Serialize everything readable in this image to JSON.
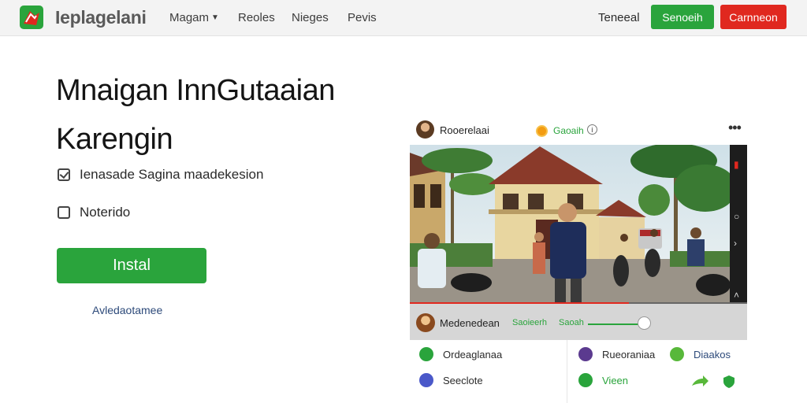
{
  "header": {
    "brand": "Ieplagelani",
    "nav": [
      {
        "label": "Magam",
        "has_dropdown": true
      },
      {
        "label": "Reoles",
        "has_dropdown": false
      },
      {
        "label": "Nieges",
        "has_dropdown": false
      },
      {
        "label": "Pevis",
        "has_dropdown": false
      }
    ],
    "link": "Teneeal",
    "green_button": "Senoeih",
    "red_button": "Carnneon"
  },
  "hero": {
    "title_line1": "Mnaigan InnGutaaian",
    "title_line2": "Karengin",
    "features": [
      {
        "label": "Ienasade Sagina maadekesion",
        "checked": true
      },
      {
        "label": "Noterido",
        "checked": false
      }
    ],
    "install_button": "Instal",
    "sub_link": "Avledaotamee"
  },
  "preview": {
    "user": "Rooerelaai",
    "badge": "Gaoaih",
    "video_progress_percent": 65,
    "caption": {
      "name": "Medenedean",
      "tag1": "Saoieerh",
      "tag2": "Saoah"
    },
    "menu_left": [
      {
        "label": "Ordeaglanaa",
        "icon": "leaf-icon",
        "color": "#2aa43c"
      },
      {
        "label": "Seeclote",
        "icon": "chat-icon",
        "color": "#4a58c9"
      }
    ],
    "menu_right": [
      {
        "label": "Rueoraniaa",
        "icon": "grid-icon",
        "color": "#5b3a8f"
      },
      {
        "label": "Diaakos",
        "icon": "leaf-icon",
        "color": "#58b83a"
      },
      {
        "label": "Vieen",
        "icon": "check-circle-icon",
        "color": "#2aa43c"
      }
    ]
  },
  "colors": {
    "accent_green": "#2aa43c",
    "accent_red": "#e0281f",
    "header_bg": "#f3f3f3"
  }
}
